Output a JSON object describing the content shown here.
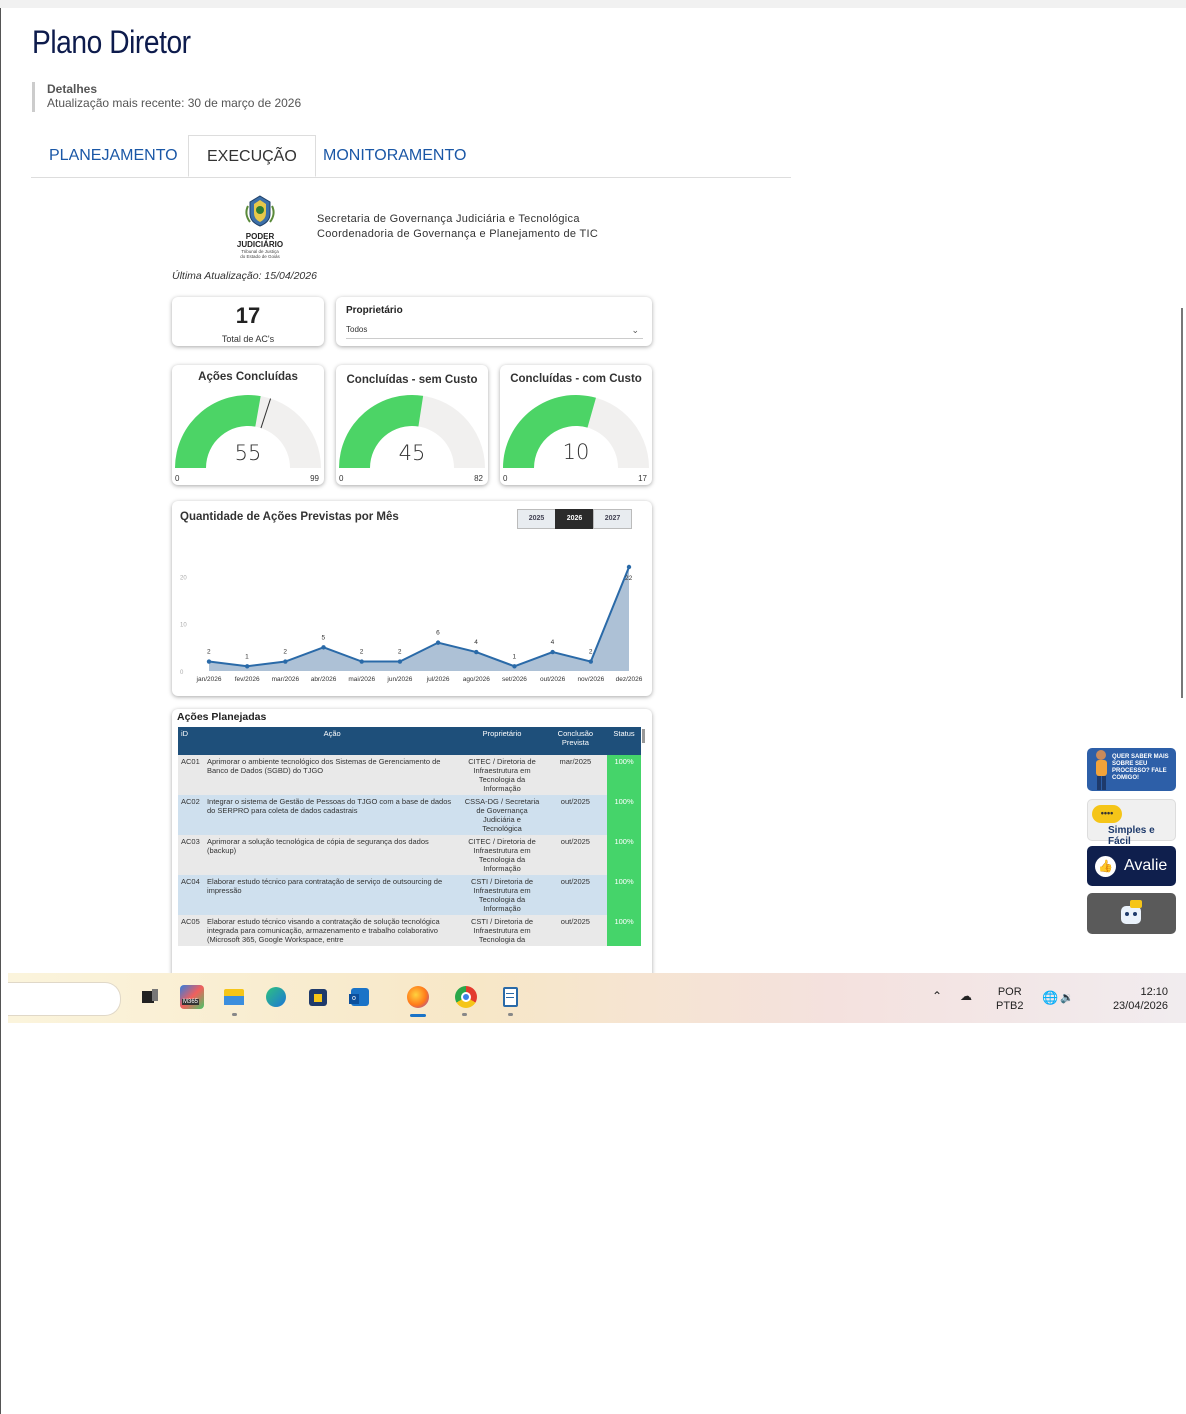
{
  "page": {
    "title": "Plano Diretor",
    "details_label": "Detalhes",
    "updated_text": "Atualização mais recente: 30 de março de 2026"
  },
  "tabs": [
    {
      "label": "PLANEJAMENTO",
      "active": false
    },
    {
      "label": "EXECUÇÃO",
      "active": true
    },
    {
      "label": "MONITORAMENTO",
      "active": false
    }
  ],
  "report": {
    "logo": {
      "line1": "PODER",
      "line2": "JUDICIÁRIO",
      "line3": "Tribunal de Justiça",
      "line4": "do Estado de Goiás"
    },
    "org_line1": "Secretaria de Governança Judiciária e Tecnológica",
    "org_line2": "Coordenadoria de Governança e Planejamento de TIC",
    "last_update": "Última Atualização: 15/04/2026",
    "kpi": {
      "value": "17",
      "label": "Total de AC's"
    },
    "slicer": {
      "title": "Proprietário",
      "selected": "Todos"
    },
    "gauges": [
      {
        "title": "Ações Concluídas",
        "value": 55,
        "min": 0,
        "max": 99,
        "target_fraction": 0.6
      },
      {
        "title": "Concluídas - sem Custo",
        "value": 45,
        "min": 0,
        "max": 82
      },
      {
        "title": "Concluídas - com Custo",
        "value": 10,
        "min": 0,
        "max": 17
      }
    ],
    "colors": {
      "gauge_fill": "#4cd466",
      "gauge_bg": "#f1f0ef",
      "line": "#2a6aa8",
      "area": "#9fb6cf",
      "header": "#1e4f7a",
      "status": "#45d46a"
    },
    "year_buttons": [
      {
        "label": "2025",
        "selected": false
      },
      {
        "label": "2026",
        "selected": true
      },
      {
        "label": "2027",
        "selected": false
      }
    ],
    "table": {
      "title": "Ações Planejadas",
      "columns": [
        "iD",
        "Ação",
        "Proprietário",
        "Conclusão Prevista",
        "Status"
      ],
      "rows": [
        {
          "id": "AC01",
          "acao": "Aprimorar o ambiente tecnológico dos Sistemas de Gerenciamento de Banco de Dados (SGBD) do TJGO",
          "prop": "CITEC / Diretoria de Infraestrutura em Tecnologia da Informação",
          "concl": "mar/2025",
          "status": "100%"
        },
        {
          "id": "AC02",
          "acao": "Integrar o sistema de Gestão de Pessoas do TJGO com a base de dados do SERPRO para coleta de dados cadastrais",
          "prop": "CSSA-DG / Secretaria de Governança Judiciária e Tecnológica",
          "concl": "out/2025",
          "status": "100%"
        },
        {
          "id": "AC03",
          "acao": "Aprimorar a solução tecnológica de cópia de segurança dos dados (backup)",
          "prop": "CITEC / Diretoria de Infraestrutura em Tecnologia da Informação",
          "concl": "out/2025",
          "status": "100%"
        },
        {
          "id": "AC04",
          "acao": "Elaborar estudo técnico para contratação de serviço de outsourcing de impressão",
          "prop": "CSTI / Diretoria de Infraestrutura em Tecnologia da Informação",
          "concl": "out/2025",
          "status": "100%"
        },
        {
          "id": "AC05",
          "acao": "Elaborar estudo técnico visando a contratação de solução tecnológica integrada para comunicação, armazenamento e trabalho colaborativo (Microsoft 365, Google Workspace, entre",
          "prop": "CSTI / Diretoria de Infraestrutura em Tecnologia da",
          "concl": "out/2025",
          "status": "100%"
        }
      ]
    }
  },
  "chart_data": {
    "type": "area",
    "title": "Quantidade de Ações Previstas por Mês",
    "categories": [
      "jan/2026",
      "fev/2026",
      "mar/2026",
      "abr/2026",
      "mai/2026",
      "jun/2026",
      "jul/2026",
      "ago/2026",
      "set/2026",
      "out/2026",
      "nov/2026",
      "dez/2026"
    ],
    "values": [
      2,
      1,
      2,
      5,
      2,
      2,
      6,
      4,
      1,
      4,
      2,
      22
    ],
    "y_ticks": [
      "0",
      "10",
      "20"
    ],
    "ylim": [
      0,
      22
    ],
    "grid": false
  },
  "side_widgets": {
    "promo": "QUER SABER MAIS SOBRE SEU PROCESSO? FALE COMIGO!",
    "simples": "Simples e Fácil",
    "avalie": "Avalie"
  },
  "taskbar": {
    "icons": [
      "task-view-icon",
      "m365-icon",
      "file-explorer-icon",
      "edge-icon",
      "store-icon",
      "outlook-icon",
      "firefox-icon",
      "chrome-icon",
      "notepad-icon"
    ],
    "m365_badge": "M365",
    "lang_line1": "POR",
    "lang_line2": "PTB2",
    "time": "12:10",
    "date": "23/04/2026"
  }
}
